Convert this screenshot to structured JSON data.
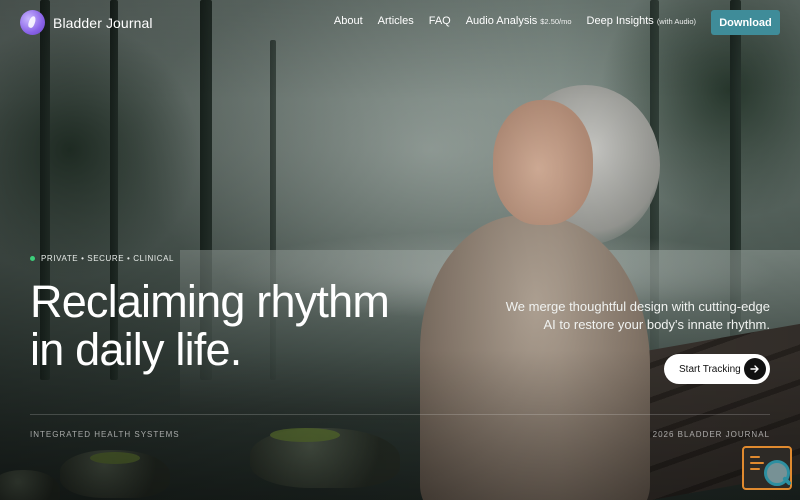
{
  "brand": {
    "name": "Bladder Journal",
    "logo_icon": "droplet-logo-icon"
  },
  "nav": {
    "about": "About",
    "articles": "Articles",
    "faq": "FAQ",
    "audio_analysis": "Audio Analysis",
    "audio_analysis_price": "$2.50/mo",
    "deep_insights": "Deep Insights",
    "deep_insights_note": "(with Audio)",
    "download": "Download"
  },
  "hero": {
    "tagline": "PRIVATE • SECURE • CLINICAL",
    "headline_line1": "Reclaiming rhythm",
    "headline_line2": "in daily life.",
    "subtext_line1": "We merge thoughtful design with cutting-edge",
    "subtext_line2": "AI to restore your body's innate rhythm.",
    "cta_label": "Start Tracking",
    "cta_icon": "arrow-right-icon"
  },
  "footer": {
    "left": "INTEGRATED HEALTH SYSTEMS",
    "right": "2026 BLADDER JOURNAL"
  },
  "colors": {
    "accent_button": "#3f8c99",
    "status_dot": "#3ccf7a",
    "logo": "#8a63e8"
  }
}
